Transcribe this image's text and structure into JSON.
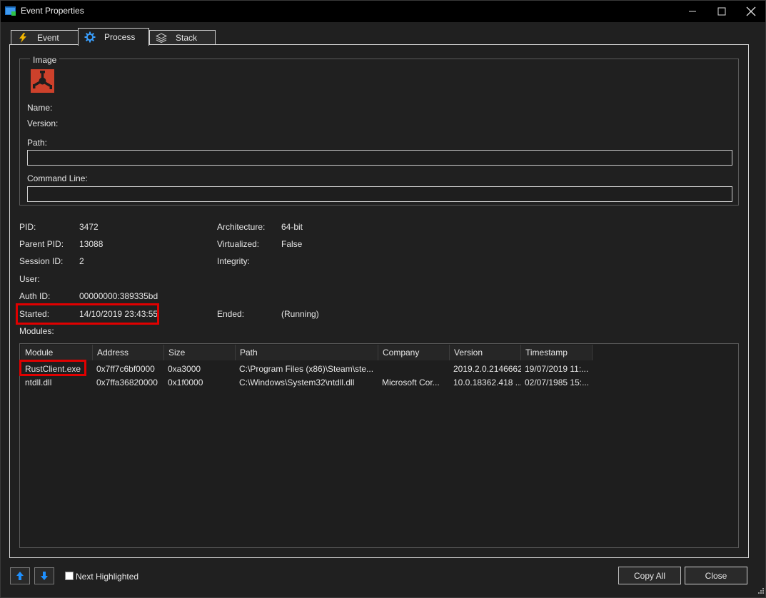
{
  "window": {
    "title": "Event Properties"
  },
  "tabs": [
    {
      "label": "Event",
      "icon": "lightning-icon"
    },
    {
      "label": "Process",
      "icon": "gear-icon"
    },
    {
      "label": "Stack",
      "icon": "stack-icon"
    }
  ],
  "image_group": {
    "title": "Image",
    "name_label": "Name:",
    "version_label": "Version:",
    "path_label": "Path:",
    "path_value": "",
    "cmdline_label": "Command Line:",
    "cmdline_value": ""
  },
  "info": {
    "pid_label": "PID:",
    "pid": "3472",
    "parent_pid_label": "Parent PID:",
    "parent_pid": "13088",
    "session_label": "Session ID:",
    "session": "2",
    "user_label": "User:",
    "auth_label": "Auth ID:",
    "auth": "00000000:389335bd",
    "started_label": "Started:",
    "started": "14/10/2019 23:43:55",
    "arch_label": "Architecture:",
    "arch": "64-bit",
    "virt_label": "Virtualized:",
    "virt": "False",
    "integrity_label": "Integrity:",
    "ended_label": "Ended:",
    "ended": "(Running)",
    "modules_label": "Modules:"
  },
  "modules": {
    "columns": [
      "Module",
      "Address",
      "Size",
      "Path",
      "Company",
      "Version",
      "Timestamp"
    ],
    "rows": [
      [
        "RustClient.exe",
        "0x7ff7c6bf0000",
        "0xa3000",
        "C:\\Program Files (x86)\\Steam\\ste...",
        "",
        "2019.2.0.2146662",
        "19/07/2019 11:..."
      ],
      [
        "ntdll.dll",
        "0x7ffa36820000",
        "0x1f0000",
        "C:\\Windows\\System32\\ntdll.dll",
        "Microsoft Cor...",
        "10.0.18362.418 ...",
        "02/07/1985 15:..."
      ]
    ]
  },
  "footer": {
    "next_highlighted": "Next Highlighted",
    "copy_all": "Copy All",
    "close": "Close"
  },
  "colors": {
    "highlight": "#e00000",
    "accent_blue": "#1e90ff"
  }
}
